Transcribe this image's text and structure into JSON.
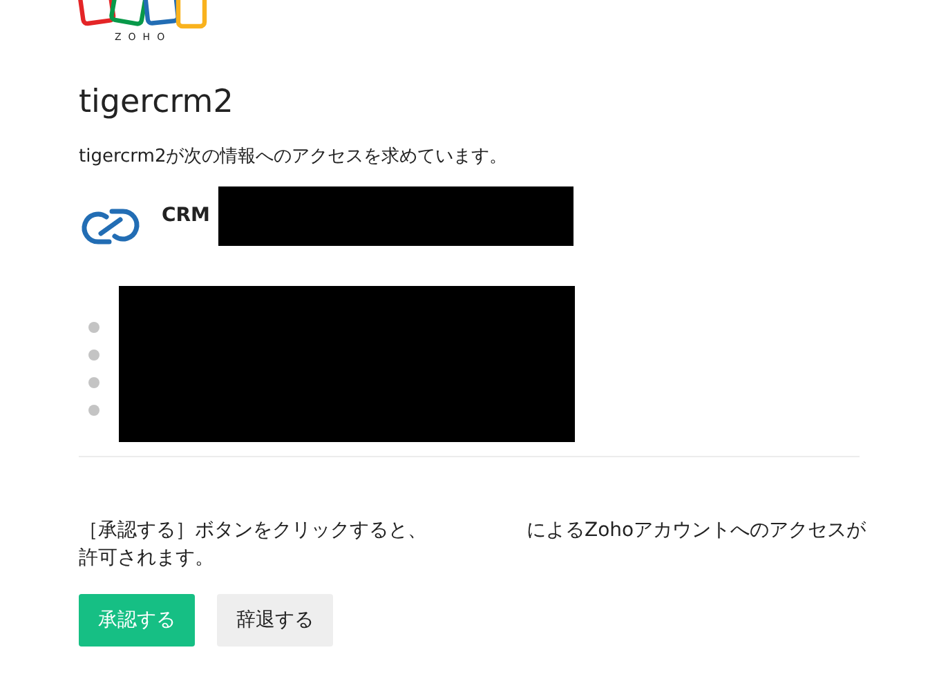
{
  "logo": {
    "wordmark": "ZOHO"
  },
  "app": {
    "title": "tigercrm2",
    "request": "tigercrm2が次の情報へのアクセスを求めています。"
  },
  "service": {
    "name": "CRM"
  },
  "consent": {
    "before": "［承認する］ボタンをクリックすると、",
    "after": "によるZohoアカウントへのアクセスが許可されます。"
  },
  "buttons": [
    {
      "label": "承認する",
      "kind": "primary"
    },
    {
      "label": "辞退する",
      "kind": "secondary"
    }
  ]
}
